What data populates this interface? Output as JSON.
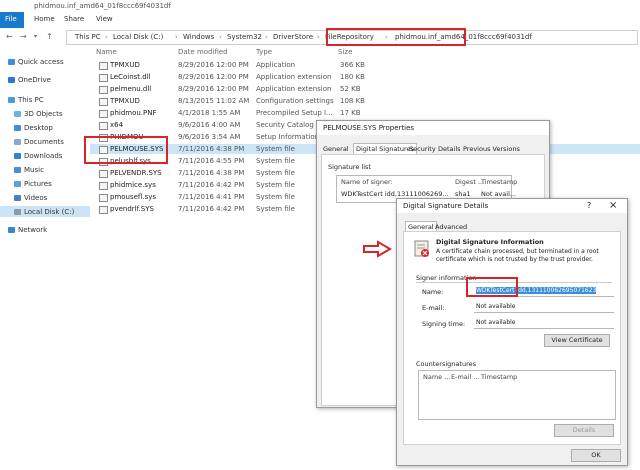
{
  "window": {
    "title": "phidmou.inf_amd64_01f8ccc69f4031df"
  },
  "ribbon": {
    "file": "File",
    "tabs": [
      "Home",
      "Share",
      "View"
    ]
  },
  "address": {
    "crumbs": [
      "This PC",
      "Local Disk (C:)",
      "Windows",
      "System32",
      "DriverStore",
      "FileRepository",
      "phidmou.inf_amd64_01f8ccc69f4031df"
    ]
  },
  "sidebar": {
    "items": [
      "Quick access",
      "OneDrive",
      "This PC",
      "3D Objects",
      "Desktop",
      "Documents",
      "Downloads",
      "Music",
      "Pictures",
      "Videos",
      "Local Disk (C:)",
      "Network"
    ]
  },
  "columns": {
    "name": "Name",
    "date": "Date modified",
    "type": "Type",
    "size": "Size"
  },
  "files": [
    {
      "name": "TPMXUD",
      "date": "8/29/2016 12:00 PM",
      "type": "Application",
      "size": "366 KB"
    },
    {
      "name": "LeCoinst.dll",
      "date": "8/29/2016 12:00 PM",
      "type": "Application extension",
      "size": "180 KB"
    },
    {
      "name": "pelmenu.dll",
      "date": "8/29/2016 12:00 PM",
      "type": "Application extension",
      "size": "52 KB"
    },
    {
      "name": "TPMXUD",
      "date": "8/13/2015 11:02 AM",
      "type": "Configuration settings",
      "size": "108 KB"
    },
    {
      "name": "phidmou.PNF",
      "date": "4/1/2018 1:55 AM",
      "type": "Precompiled Setup I...",
      "size": "17 KB"
    },
    {
      "name": "x64",
      "date": "9/6/2016 4:00 AM",
      "type": "Security Catalog",
      "size": ""
    },
    {
      "name": "PHIDMOU",
      "date": "9/6/2016 3:54 AM",
      "type": "Setup Information",
      "size": ""
    },
    {
      "name": "PELMOUSE.SYS",
      "date": "7/11/2016 4:38 PM",
      "type": "System file",
      "size": ""
    },
    {
      "name": "pelusblf.sys",
      "date": "7/11/2016 4:55 PM",
      "type": "System file",
      "size": ""
    },
    {
      "name": "PELVENDR.SYS",
      "date": "7/11/2016 4:38 PM",
      "type": "System file",
      "size": ""
    },
    {
      "name": "phidmice.sys",
      "date": "7/11/2016 4:42 PM",
      "type": "System file",
      "size": ""
    },
    {
      "name": "pmousefl.sys",
      "date": "7/11/2016 4:41 PM",
      "type": "System file",
      "size": ""
    },
    {
      "name": "pvendrlf.SYS",
      "date": "7/11/2016 4:42 PM",
      "type": "System file",
      "size": ""
    }
  ],
  "props": {
    "title": "PELMOUSE.SYS Properties",
    "tabs": [
      "General",
      "Digital Signatures",
      "Security",
      "Details",
      "Previous Versions"
    ],
    "siglist_label": "Signature list",
    "cols": [
      "Name of signer:",
      "Digest ...",
      "Timestamp"
    ],
    "row": [
      "WDKTestCert idd,13111006269...",
      "sha1",
      "Not avail..."
    ]
  },
  "details": {
    "title": "Digital Signature Details",
    "help": "?",
    "close": "×",
    "tabs": [
      "General",
      "Advanced"
    ],
    "info_title": "Digital Signature Information",
    "info_text1": "A certificate chain processed, but terminated in a root",
    "info_text2": "certificate which is not trusted by the trust provider.",
    "signer_label": "Signer information",
    "name_label": "Name:",
    "name_value": "WDKTestCert idd,131110062695071623",
    "email_label": "E-mail:",
    "email_value": "Not available",
    "time_label": "Signing time:",
    "time_value": "Not available",
    "view_cert": "View Certificate",
    "counter_label": "Countersignatures",
    "counter_cols": [
      "Name ...",
      "E-mail ...",
      "Timestamp"
    ],
    "details_btn": "Details",
    "ok": "OK"
  },
  "colors": {
    "accent": "#1979ca",
    "highlight": "#d7262b",
    "selection": "#cde6f7"
  }
}
